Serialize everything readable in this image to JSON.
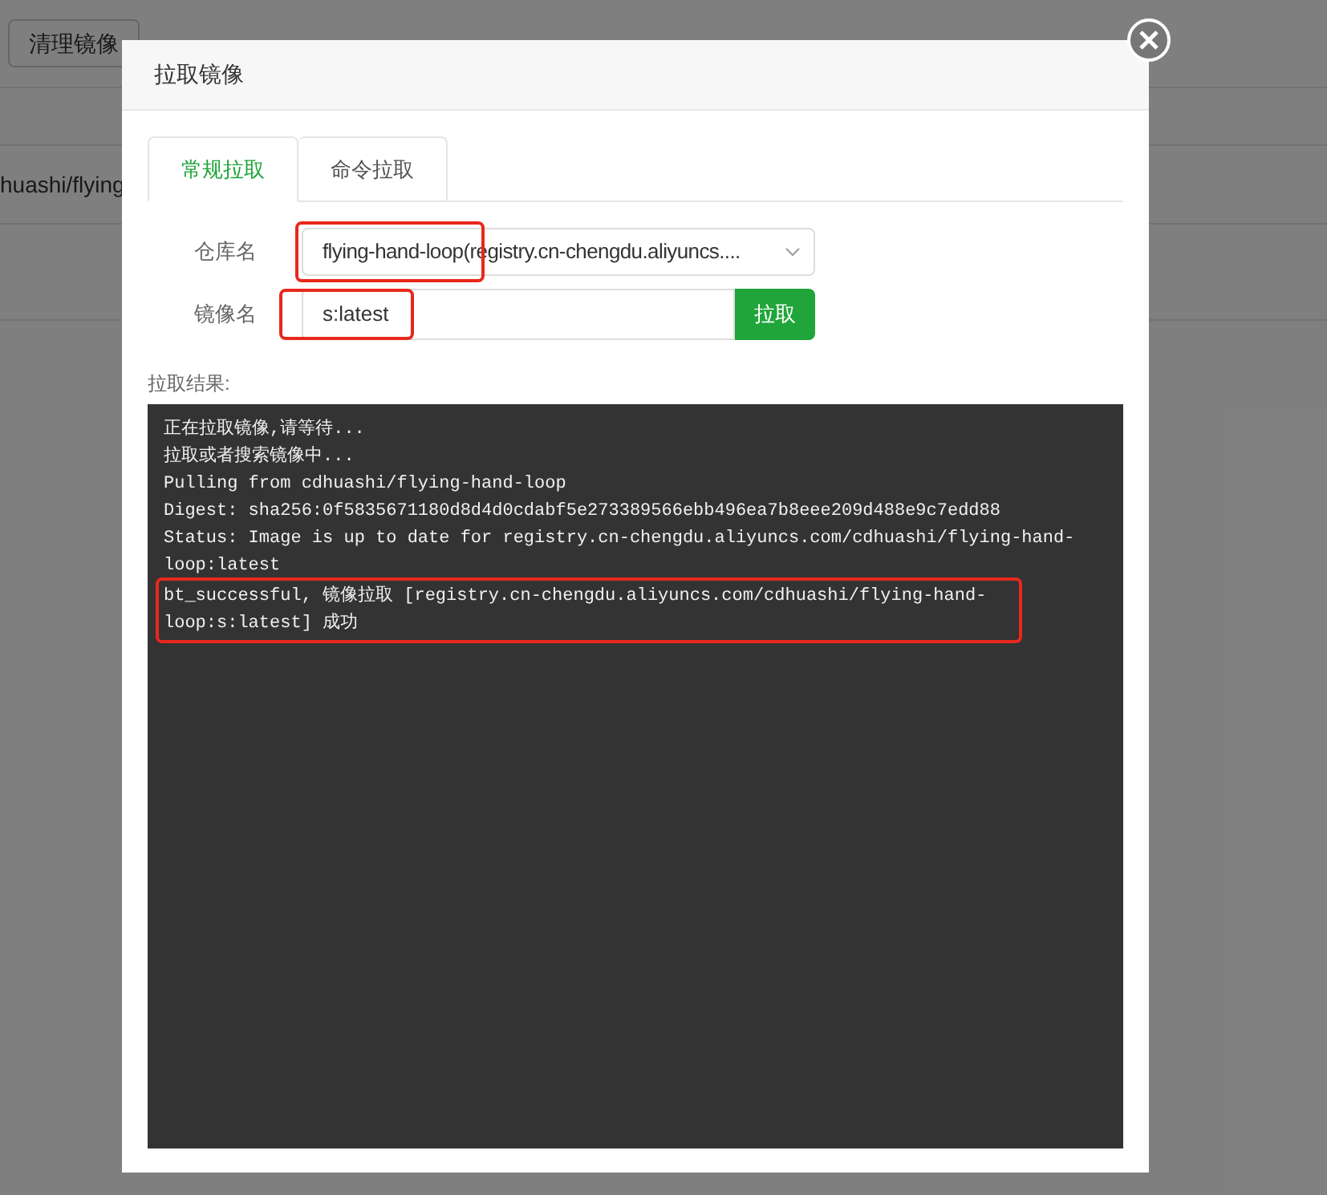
{
  "page": {
    "toolbar_button": "清理镜像",
    "row_text": "huashi/flying"
  },
  "dialog": {
    "title": "拉取镜像",
    "tabs": [
      {
        "label": "常规拉取",
        "selected": true
      },
      {
        "label": "命令拉取",
        "selected": false
      }
    ],
    "repository": {
      "label": "仓库名",
      "value": "flying-hand-loop(registry.cn-chengdu.aliyuncs....",
      "highlighted": true
    },
    "image": {
      "label": "镜像名",
      "value": "s:latest",
      "highlighted": true,
      "button": "拉取"
    },
    "result_label": "拉取结果:",
    "log": [
      {
        "text": "正在拉取镜像,请等待...",
        "highlighted": false
      },
      {
        "text": "拉取或者搜索镜像中...",
        "highlighted": false
      },
      {
        "text": "Pulling from cdhuashi/flying-hand-loop",
        "highlighted": false
      },
      {
        "text": "Digest: sha256:0f5835671180d8d4d0cdabf5e273389566ebb496ea7b8eee209d488e9c7edd88",
        "highlighted": false
      },
      {
        "text": "Status: Image is up to date for registry.cn-chengdu.aliyuncs.com/cdhuashi/flying-hand-loop:latest",
        "highlighted": false
      },
      {
        "text": "bt_successful, 镜像拉取 [registry.cn-chengdu.aliyuncs.com/cdhuashi/flying-hand-loop:s:latest] 成功",
        "highlighted": true
      }
    ]
  }
}
